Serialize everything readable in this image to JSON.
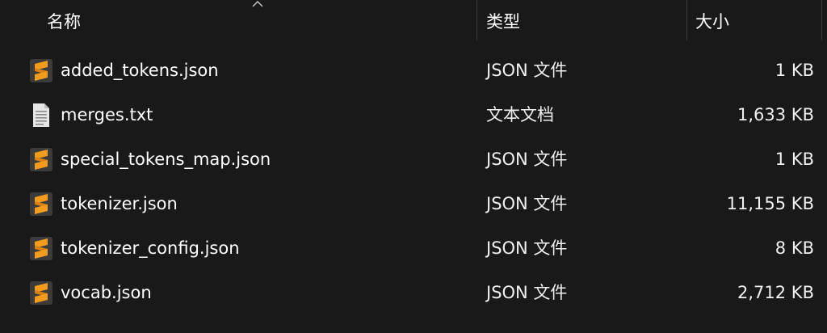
{
  "header": {
    "name_label": "名称",
    "type_label": "类型",
    "size_label": "大小"
  },
  "colors": {
    "background": "#191919",
    "sublime_icon_bg": "#3b3b3b",
    "sublime_icon_fg": "#f39c1c",
    "text_icon_fg": "#e6e6e6"
  },
  "files": [
    {
      "name": "added_tokens.json",
      "type": "JSON 文件",
      "size": "1 KB",
      "icon": "sublime-text-icon"
    },
    {
      "name": "merges.txt",
      "type": "文本文档",
      "size": "1,633 KB",
      "icon": "text-file-icon"
    },
    {
      "name": "special_tokens_map.json",
      "type": "JSON 文件",
      "size": "1 KB",
      "icon": "sublime-text-icon"
    },
    {
      "name": "tokenizer.json",
      "type": "JSON 文件",
      "size": "11,155 KB",
      "icon": "sublime-text-icon"
    },
    {
      "name": "tokenizer_config.json",
      "type": "JSON 文件",
      "size": "8 KB",
      "icon": "sublime-text-icon"
    },
    {
      "name": "vocab.json",
      "type": "JSON 文件",
      "size": "2,712 KB",
      "icon": "sublime-text-icon"
    }
  ]
}
